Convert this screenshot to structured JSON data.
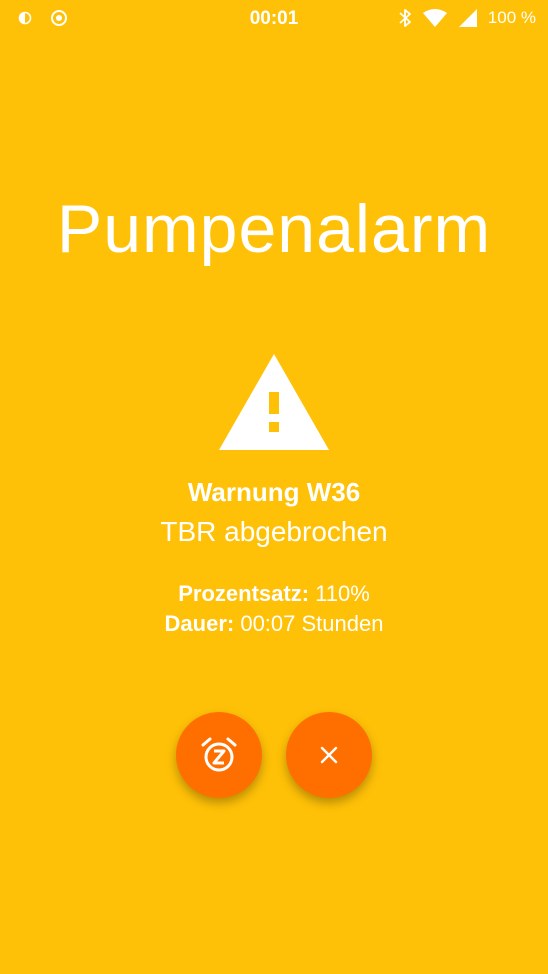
{
  "status_bar": {
    "time": "00:01",
    "battery_percent": "100 %",
    "icons": [
      "data-saver-icon",
      "sync-icon",
      "bluetooth-icon",
      "wifi-icon",
      "cell-signal-icon"
    ]
  },
  "alarm": {
    "title": "Pumpenalarm",
    "icon": "warning-triangle-icon",
    "code": "Warnung W36",
    "description": "TBR abgebrochen",
    "details": [
      {
        "label": "Prozentsatz:",
        "value": " 110%"
      },
      {
        "label": "Dauer:",
        "value": " 00:07 Stunden"
      }
    ]
  },
  "actions": {
    "snooze_icon": "snooze-alarm-icon",
    "dismiss_icon": "close-icon"
  },
  "colors": {
    "background": "#FFC107",
    "fab": "#FF6F00",
    "text": "#FFFFFF"
  }
}
